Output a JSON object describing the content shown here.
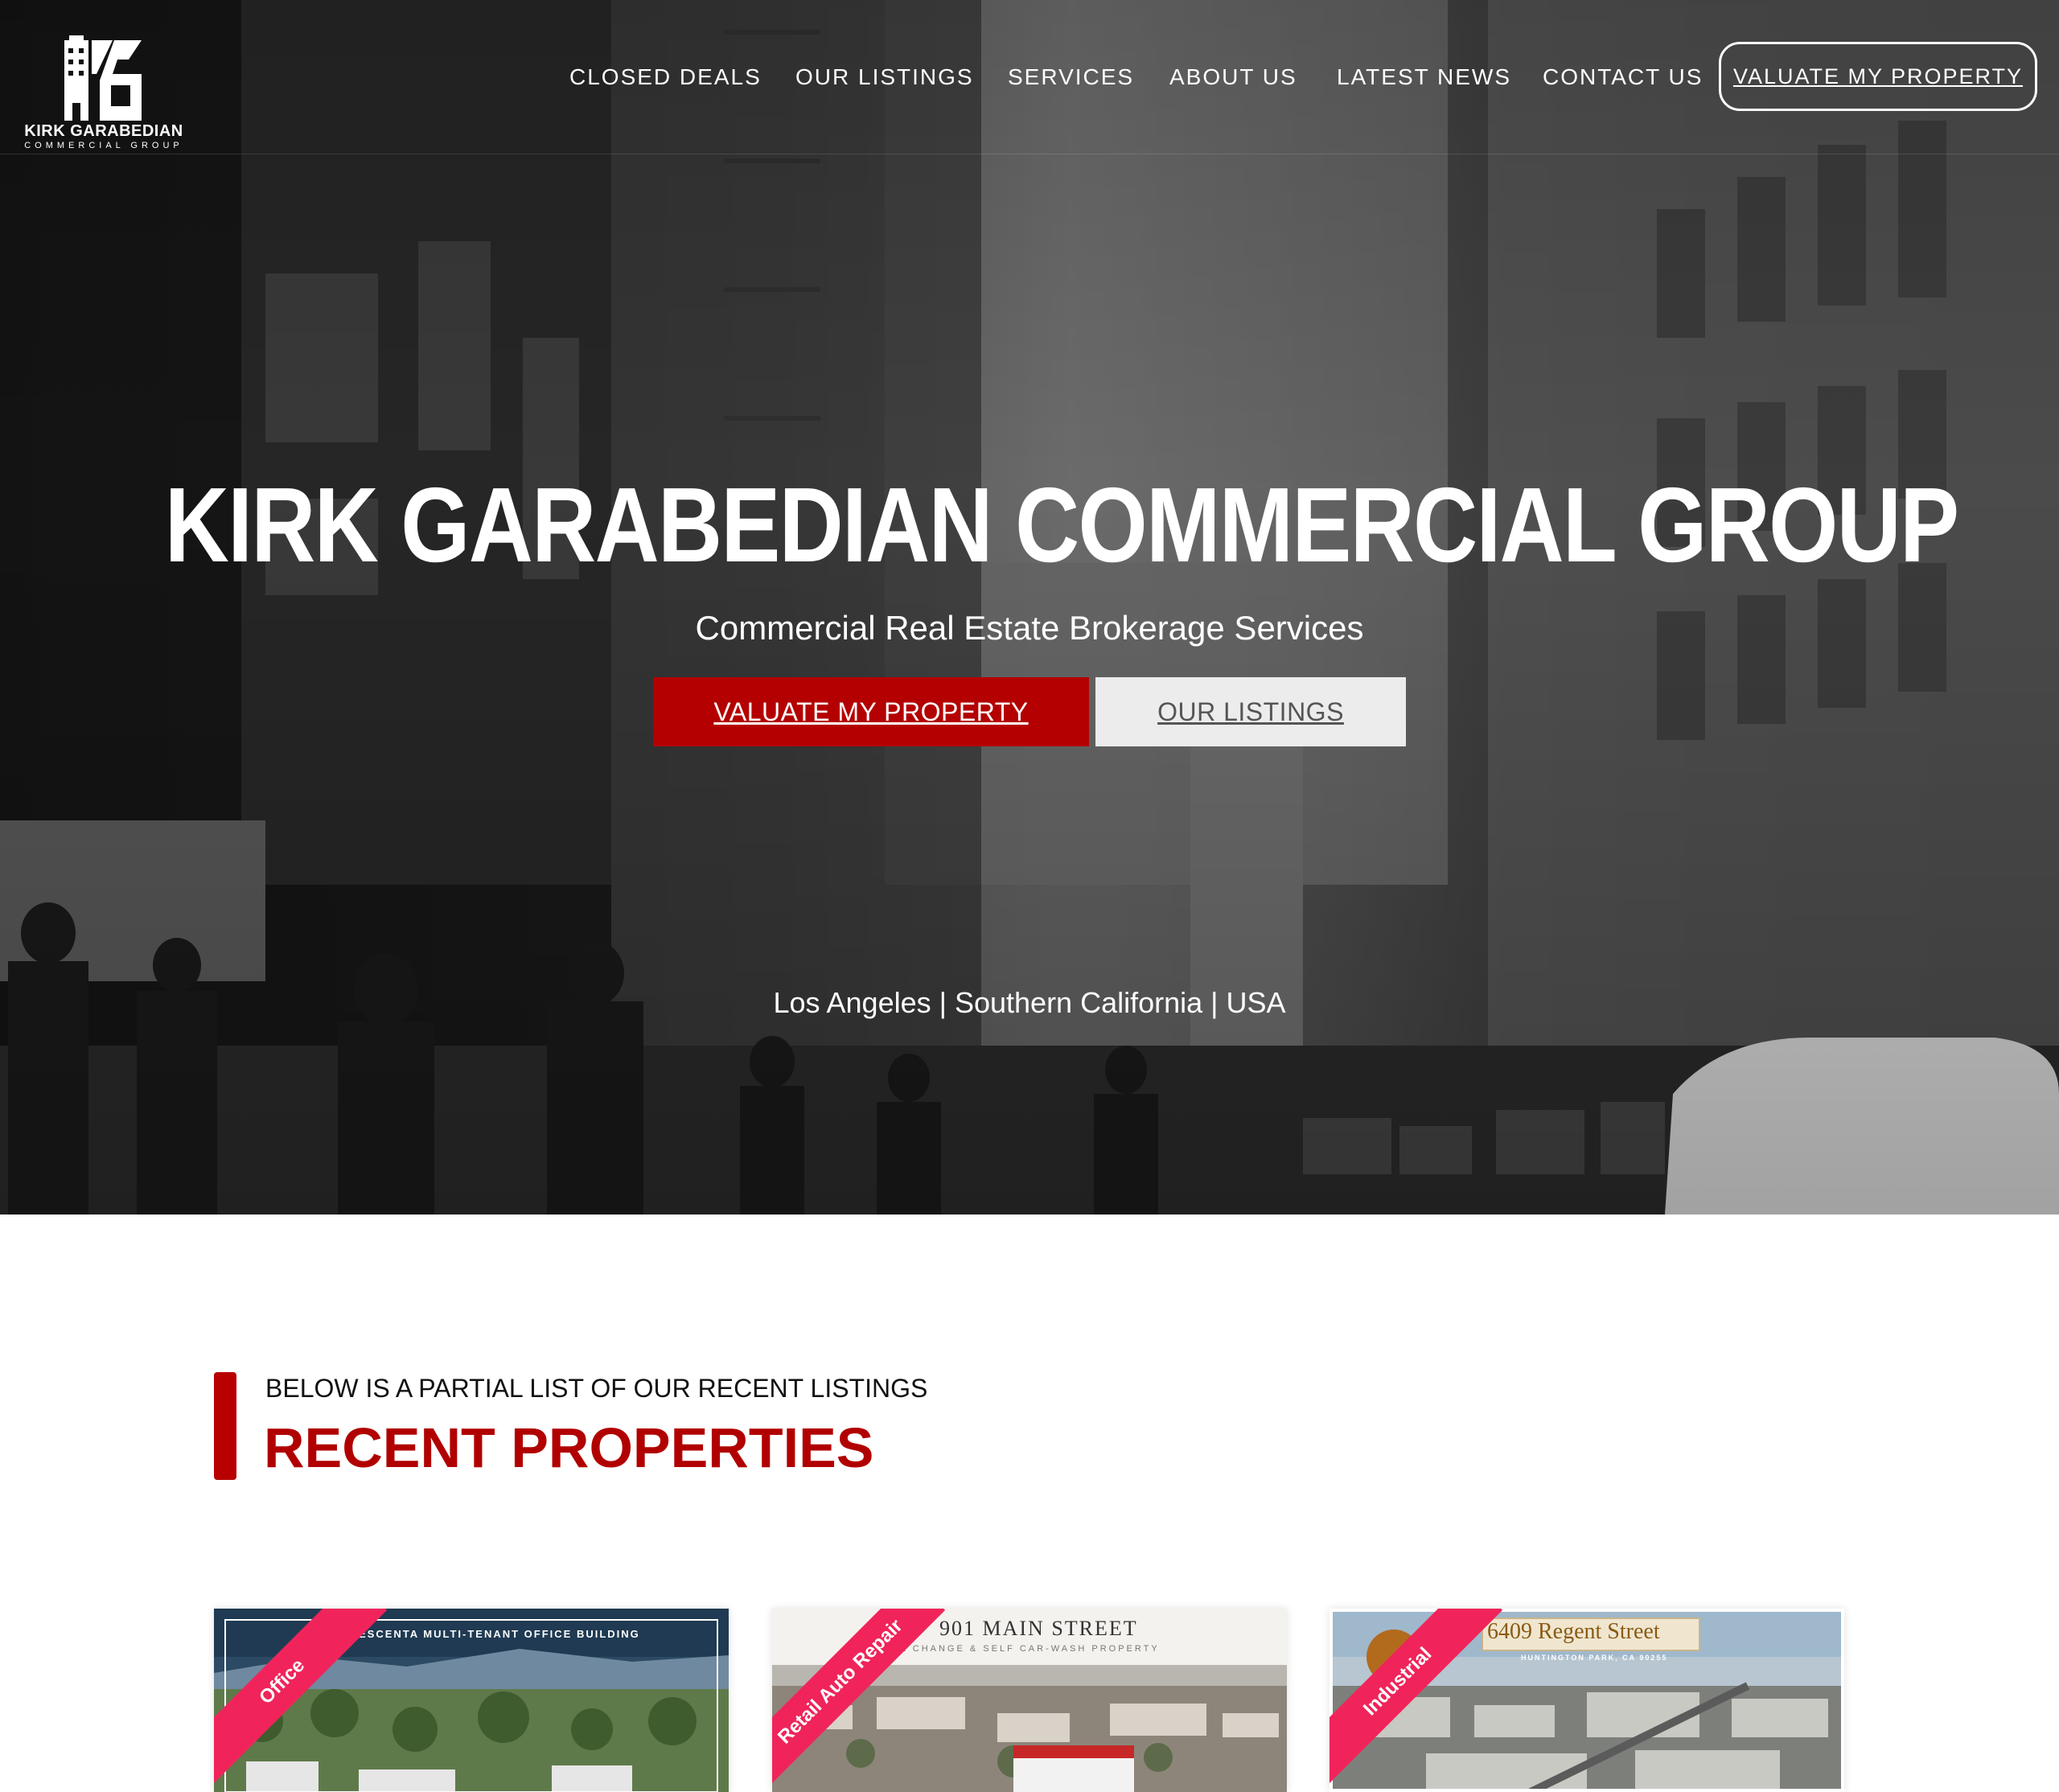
{
  "brand": {
    "name": "KIRK GARABEDIAN",
    "sub": "COMMERCIAL GROUP"
  },
  "nav": {
    "items": [
      {
        "label": "CLOSED DEALS"
      },
      {
        "label": "OUR LISTINGS"
      },
      {
        "label": "SERVICES"
      },
      {
        "label": "ABOUT US"
      },
      {
        "label": "LATEST NEWS"
      },
      {
        "label": "CONTACT US"
      }
    ],
    "cta": "VALUATE MY PROPERTY"
  },
  "hero": {
    "title": "KIRK GARABEDIAN COMMERCIAL GROUP",
    "subtitle": "Commercial Real Estate Brokerage Services",
    "primary_button": "VALUATE MY PROPERTY",
    "secondary_button": "OUR LISTINGS",
    "location": "Los Angeles | Southern California | USA"
  },
  "section": {
    "kicker": "BELOW IS A PARTIAL LIST OF OUR RECENT LISTINGS",
    "title": "RECENT PROPERTIES"
  },
  "properties": [
    {
      "category": "Office",
      "caption": "ESCENTA MULTI-TENANT OFFICE BUILDING"
    },
    {
      "category": "Retail Auto Repair",
      "caption": "901 MAIN STREET",
      "caption_sub": "L CHANGE & SELF CAR-WASH PROPERTY"
    },
    {
      "category": "Industrial",
      "caption": "6409 Regent Street",
      "caption_sub": "HUNTINGTON PARK, CA 90255"
    }
  ],
  "colors": {
    "accent_red": "#b40000",
    "ribbon_pink": "#f0245a",
    "title_red": "#b10000"
  }
}
